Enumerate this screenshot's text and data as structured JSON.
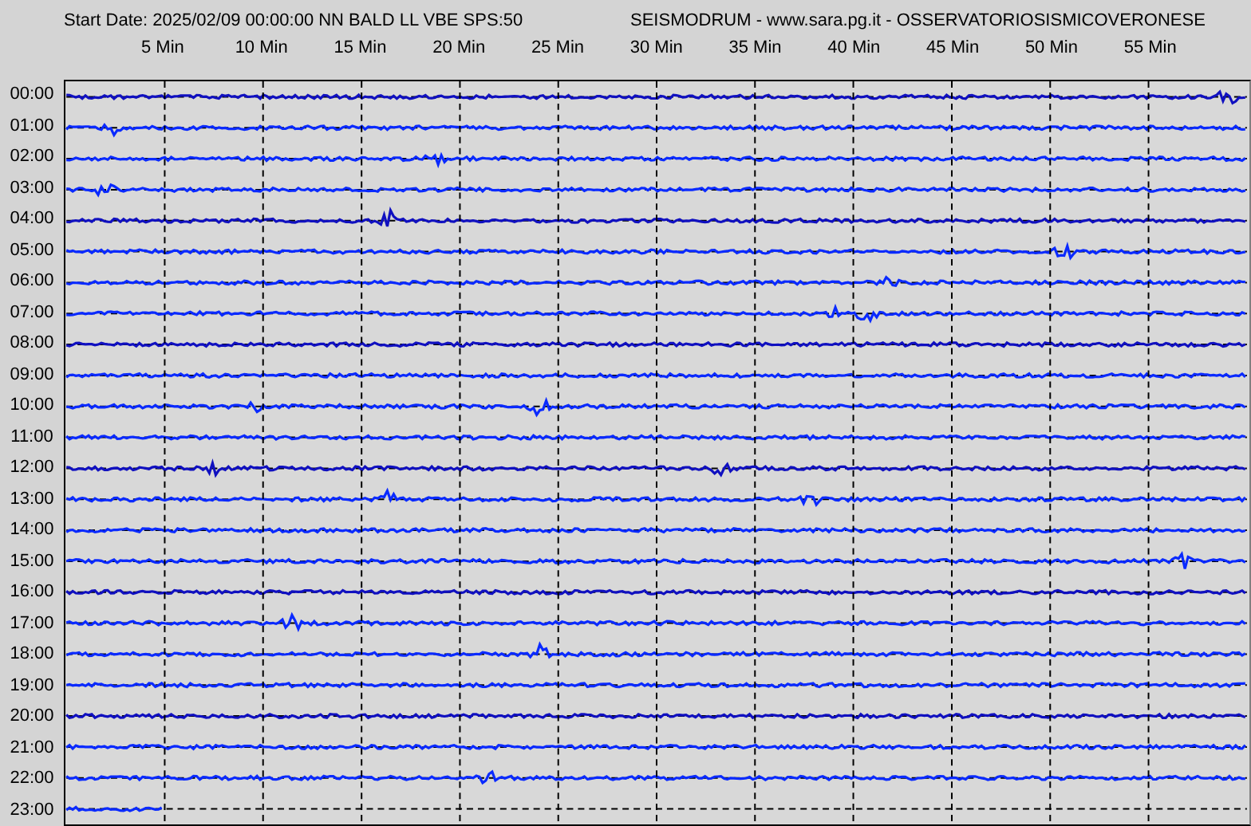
{
  "header": {
    "start_info": "Start Date: 2025/02/09 00:00:00 NN BALD LL VBE SPS:50",
    "source": "SEISMODRUM - www.sara.pg.it - OSSERVATORIOSISMICOVERONESE"
  },
  "minute_ticks": [
    "5 Min",
    "10 Min",
    "15 Min",
    "20 Min",
    "25 Min",
    "30 Min",
    "35 Min",
    "40 Min",
    "45 Min",
    "50 Min",
    "55 Min"
  ],
  "rows": [
    {
      "label": "00:00",
      "level": 1
    },
    {
      "label": "01:00",
      "level": 1
    },
    {
      "label": "02:00",
      "level": 1
    },
    {
      "label": "03:00",
      "level": 1
    },
    {
      "label": "04:00",
      "level": 1
    },
    {
      "label": "05:00",
      "level": 1
    },
    {
      "label": "06:00",
      "level": 1
    },
    {
      "label": "07:00",
      "level": 1
    },
    {
      "label": "08:00",
      "level": 1
    },
    {
      "label": "09:00",
      "level": 1
    },
    {
      "label": "10:00",
      "level": 1
    },
    {
      "label": "11:00",
      "level": 1
    },
    {
      "label": "12:00",
      "level": 1
    },
    {
      "label": "13:00",
      "level": 1
    },
    {
      "label": "14:00",
      "level": 1
    },
    {
      "label": "15:00",
      "level": 1
    },
    {
      "label": "16:00",
      "level": 1
    },
    {
      "label": "17:00",
      "level": 1
    },
    {
      "label": "18:00",
      "level": 1
    },
    {
      "label": "19:00",
      "level": 1
    },
    {
      "label": "20:00",
      "level": 1
    },
    {
      "label": "21:00",
      "level": 1
    },
    {
      "label": "22:00",
      "level": 1
    },
    {
      "label": "23:00",
      "level": 0.083
    }
  ]
}
